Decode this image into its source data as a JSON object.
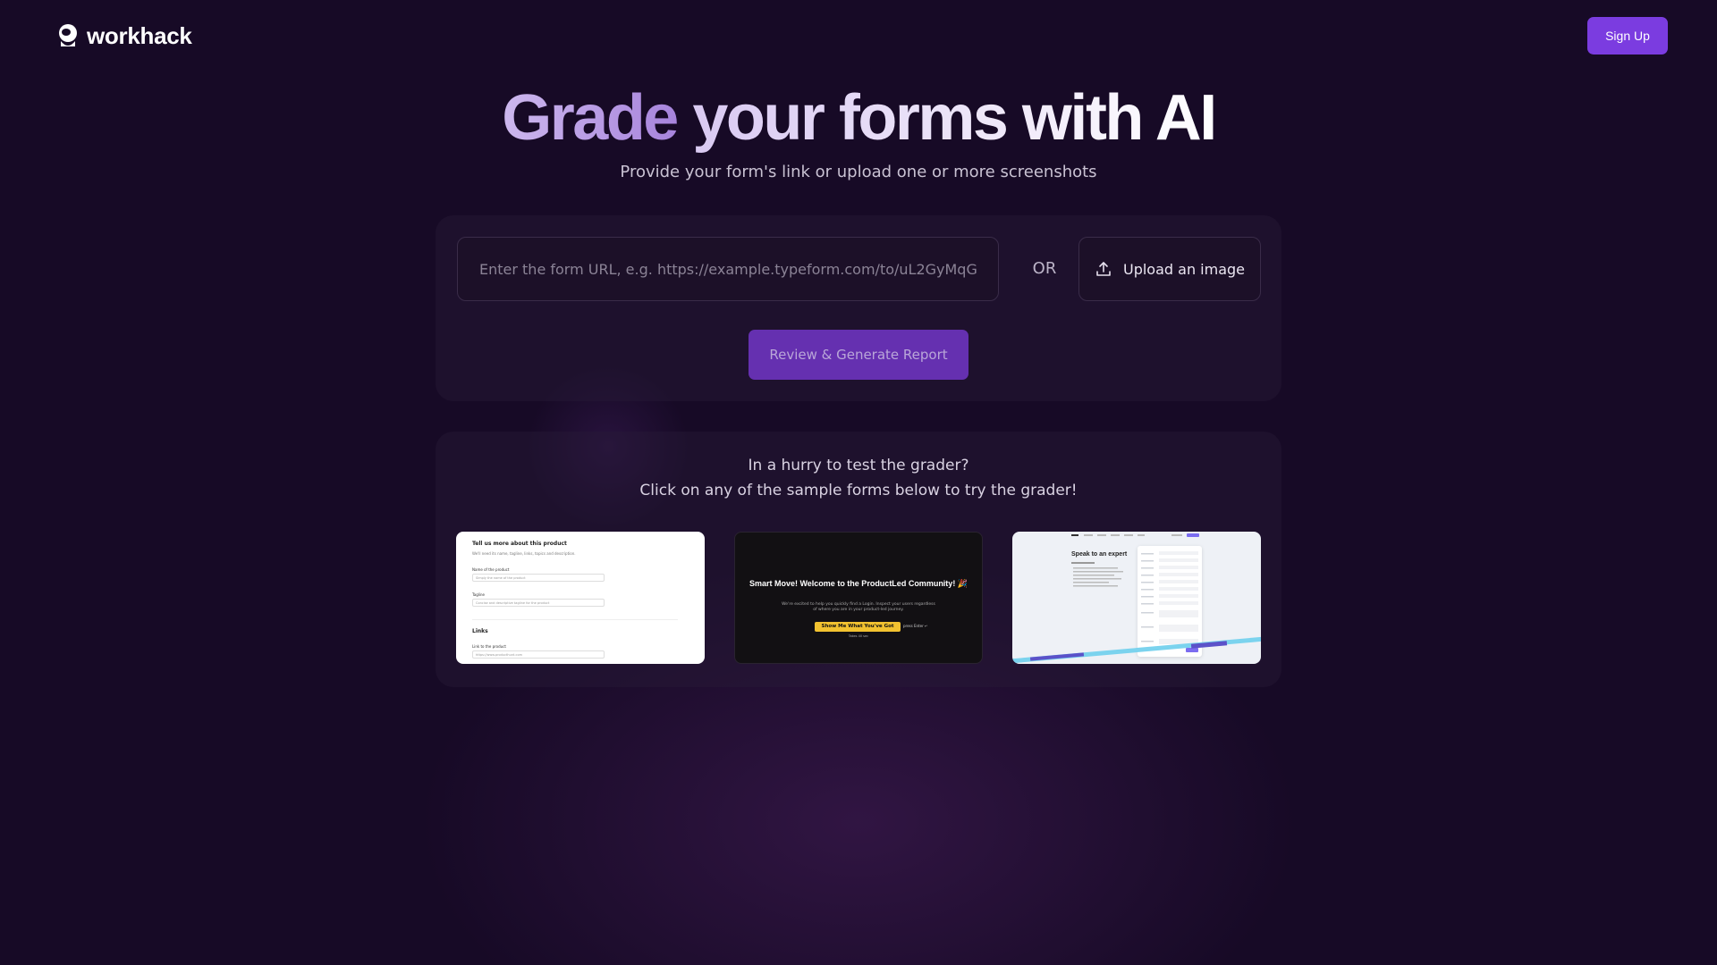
{
  "header": {
    "brand": "workhack",
    "signup_label": "Sign Up"
  },
  "hero": {
    "title_accent": "Grade",
    "title_rest": "your forms with AI",
    "subtitle": "Provide your form's link or upload one or more screenshots"
  },
  "form": {
    "url_placeholder": "Enter the form URL, e.g. https://example.typeform.com/to/uL2GyMqG",
    "url_value": "",
    "or_label": "OR",
    "upload_label": "Upload an image",
    "review_label": "Review & Generate Report"
  },
  "samples": {
    "line1": "In a hurry to test the grader?",
    "line2": "Click on any of the sample forms below to try the grader!",
    "items": [
      {
        "heading": "Tell us more about this product",
        "subheading": "We'll need its name, tagline, links, topics and description.",
        "field1_label": "Name of the product",
        "field1_placeholder": "Simply the name of the product",
        "field2_label": "Tagline",
        "field2_placeholder": "Concise and descriptive tagline for the product",
        "section": "Links",
        "field3_label": "Link to the product",
        "field3_placeholder": "https://www.producthunt.com"
      },
      {
        "heading": "Smart Move! Welcome to the ProductLed Community! 🎉",
        "body": "We're excited to help you quickly find a Login. Inspect your users regardless of where you are in your product-led journey.",
        "cta": "Show Me What You've Got",
        "secondary": "press Enter ↵",
        "footnote": "Takes 40 sec"
      },
      {
        "heading": "Speak to an expert"
      }
    ]
  },
  "colors": {
    "background": "#170a26",
    "accent": "#7b3ce0",
    "review_button": "#6530b0"
  }
}
